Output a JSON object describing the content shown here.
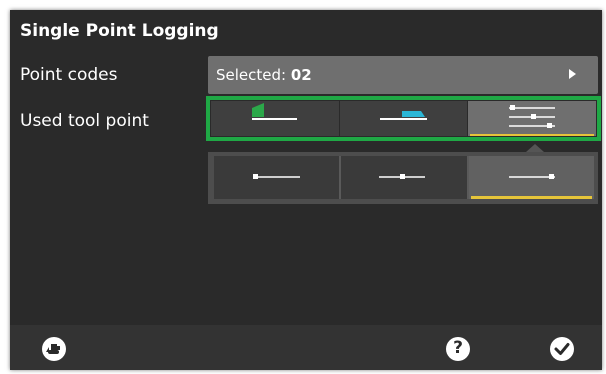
{
  "header": {
    "title": "Single Point Logging"
  },
  "rows": {
    "point_codes": {
      "label": "Point codes",
      "select_prefix": "Selected: ",
      "select_value": "02"
    },
    "used_tool_point": {
      "label": "Used tool point"
    }
  },
  "tool_point_segments": [
    {
      "icon": "blade-edge-left-icon",
      "selected": false
    },
    {
      "icon": "blade-edge-center-icon",
      "selected": false
    },
    {
      "icon": "custom-points-list-icon",
      "selected": true
    }
  ],
  "sub_segments": [
    {
      "icon": "point-left-icon",
      "selected": false
    },
    {
      "icon": "point-center-icon",
      "selected": false
    },
    {
      "icon": "point-right-icon",
      "selected": true
    }
  ],
  "footer": {
    "left_icon": "machine-icon",
    "help_icon": "help-icon",
    "confirm_icon": "checkmark-icon"
  },
  "colors": {
    "panel_bg": "#2a2a2a",
    "accent_green": "#1fa845",
    "accent_yellow": "#e6c53a",
    "icon_cyan": "#2bb6d6",
    "icon_green": "#2ca84a"
  }
}
